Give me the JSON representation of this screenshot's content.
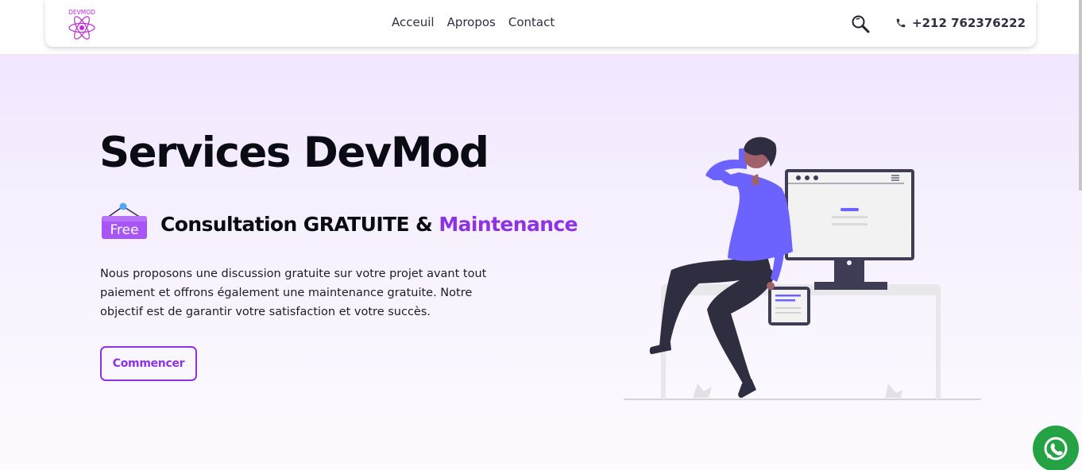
{
  "header": {
    "logo_text": "DEVMOD",
    "nav": [
      {
        "label": "Acceuil"
      },
      {
        "label": "Apropos"
      },
      {
        "label": "Contact"
      }
    ],
    "phone": "+212 762376222"
  },
  "hero": {
    "title": "Services DevMod",
    "badge_label": "Free",
    "subtitle_main": "Consultation GRATUITE & ",
    "subtitle_accent": "Maintenance",
    "description": "Nous proposons une discussion gratuite sur votre projet avant tout paiement et offrons également une maintenance gratuite. Notre objectif est de garantir votre satisfaction et votre succès.",
    "cta_label": "Commencer"
  },
  "icons": {
    "search": "search-icon",
    "phone": "phone-icon",
    "whatsapp": "whatsapp-icon"
  },
  "colors": {
    "accent": "#8d33e3",
    "badge": "#a855f7",
    "illustration_primary": "#6c63ff",
    "whatsapp": "#25a244",
    "text_dark": "#0b0b14"
  }
}
